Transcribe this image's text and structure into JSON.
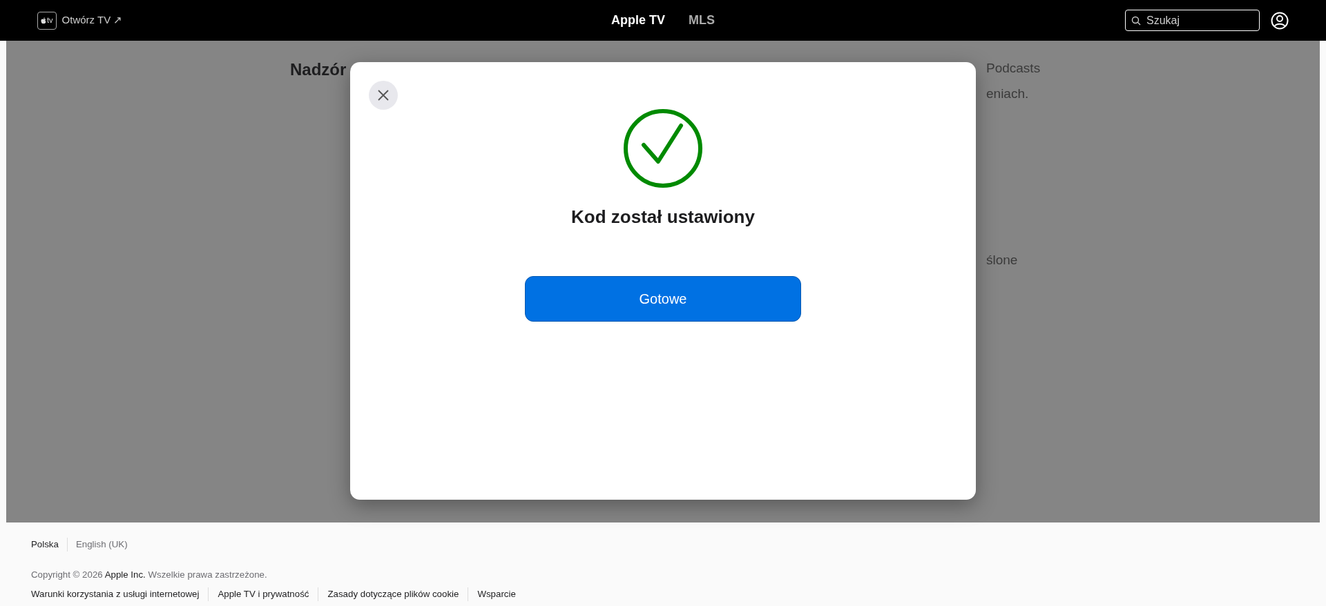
{
  "nav": {
    "logo_text": "tv",
    "open_link": "Otwórz TV ↗",
    "tabs": [
      {
        "label": "Apple TV",
        "selected": true
      },
      {
        "label": "MLS",
        "selected": false
      }
    ],
    "search": {
      "placeholder": "Szukaj"
    }
  },
  "background": {
    "heading": "Nadzór",
    "fragments": [
      "Podcasts",
      "eniach.",
      "ślone"
    ]
  },
  "dialog": {
    "title": "Kod został ustawiony",
    "button": "Gotowe"
  },
  "footer": {
    "languages": [
      {
        "label": "Polska",
        "selected": true
      },
      {
        "label": "English (UK)",
        "selected": false
      }
    ],
    "copyright": {
      "prefix": "Copyright © 2026",
      "company": "Apple Inc.",
      "suffix": "Wszelkie prawa zastrzeżone."
    },
    "links": [
      "Warunki korzystania z usługi internetowej",
      "Apple TV i prywatność",
      "Zasady dotyczące plików cookie",
      "Wsparcie"
    ]
  }
}
